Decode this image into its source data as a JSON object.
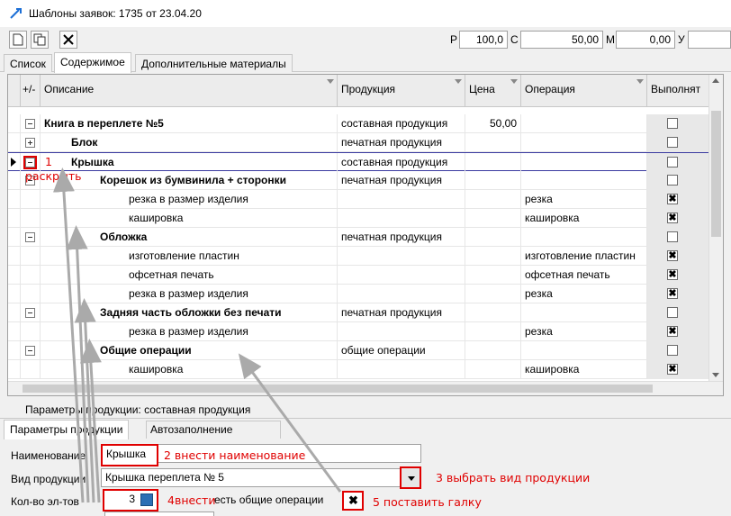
{
  "window": {
    "title": "Шаблоны заявок: 1735 от 23.04.20"
  },
  "toolbar": {
    "fields": [
      {
        "label": "P",
        "value": "100,0"
      },
      {
        "label": "C",
        "value": "50,00"
      },
      {
        "label": "M",
        "value": "0,00"
      },
      {
        "label": "У",
        "value": ""
      }
    ]
  },
  "tabs": [
    "Список",
    "Содержимое",
    "Дополнительные материалы"
  ],
  "grid": {
    "headers": [
      "+/-",
      "Описание",
      "Продукция",
      "Цена",
      "Операция",
      "Выполнят"
    ],
    "rows": [
      {
        "toggle": "minus",
        "desc": "Книга в переплете №5",
        "bold": true,
        "indent": 0,
        "product": "составная продукция",
        "price": "50,00",
        "op": "",
        "check": ""
      },
      {
        "toggle": "plus",
        "desc": "Блок",
        "bold": true,
        "indent": 1,
        "product": "печатная продукция",
        "price": "",
        "op": "",
        "check": ""
      },
      {
        "toggle": "minus",
        "desc": "Крышка",
        "bold": true,
        "indent": 1,
        "product": "составная продукция",
        "price": "",
        "op": "",
        "check": ""
      },
      {
        "toggle": "minus",
        "desc": "Корешок из бумвинила + сторонки",
        "bold": true,
        "indent": 2,
        "product": "печатная продукция",
        "price": "",
        "op": "",
        "check": ""
      },
      {
        "toggle": "",
        "desc": "резка в размер изделия",
        "bold": false,
        "indent": 3,
        "product": "",
        "price": "",
        "op": "резка",
        "check": "✖"
      },
      {
        "toggle": "",
        "desc": "кашировка",
        "bold": false,
        "indent": 3,
        "product": "",
        "price": "",
        "op": "кашировка",
        "check": "✖"
      },
      {
        "toggle": "minus",
        "desc": "Обложка",
        "bold": true,
        "indent": 2,
        "product": "печатная продукция",
        "price": "",
        "op": "",
        "check": ""
      },
      {
        "toggle": "",
        "desc": "изготовление пластин",
        "bold": false,
        "indent": 3,
        "product": "",
        "price": "",
        "op": "изготовление пластин",
        "check": "✖"
      },
      {
        "toggle": "",
        "desc": "офсетная печать",
        "bold": false,
        "indent": 3,
        "product": "",
        "price": "",
        "op": "офсетная печать",
        "check": "✖"
      },
      {
        "toggle": "",
        "desc": "резка в размер изделия",
        "bold": false,
        "indent": 3,
        "product": "",
        "price": "",
        "op": "резка",
        "check": "✖"
      },
      {
        "toggle": "minus",
        "desc": "Задняя часть обложки без печати",
        "bold": true,
        "indent": 2,
        "product": "печатная продукция",
        "price": "",
        "op": "",
        "check": ""
      },
      {
        "toggle": "",
        "desc": "резка в размер изделия",
        "bold": false,
        "indent": 3,
        "product": "",
        "price": "",
        "op": "резка",
        "check": "✖"
      },
      {
        "toggle": "minus",
        "desc": "Общие операции",
        "bold": true,
        "indent": 2,
        "product": "общие операции",
        "price": "",
        "op": "",
        "check": ""
      },
      {
        "toggle": "",
        "desc": "кашировка",
        "bold": false,
        "indent": 3,
        "product": "",
        "price": "",
        "op": "кашировка",
        "check": "✖"
      }
    ]
  },
  "params": {
    "caption": "Параметры продукции: составная продукция",
    "tabs": [
      "Параметры продукции",
      "Автозаполнение"
    ],
    "name_label": "Наименование",
    "name_value": "Крышка",
    "type_label": "Вид продукции",
    "type_value": "Крышка переплета № 5",
    "count_label": "Кол-во эл-тов",
    "count_value": "3",
    "common_ops_label": "есть общие операции",
    "common_ops_checked": "✖"
  },
  "annotations": {
    "n1": "1",
    "expand": "раскрыть",
    "n2": "2  внести наименование",
    "n3": "3  выбрать вид продукции",
    "n4": "4внести",
    "n5": "5  поставить галку"
  }
}
